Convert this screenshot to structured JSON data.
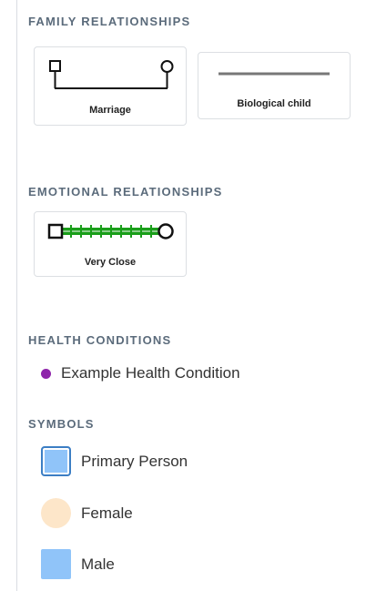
{
  "sections": {
    "family": {
      "title": "FAMILY RELATIONSHIPS",
      "items": [
        {
          "label": "Marriage",
          "icon": "marriage-connector-icon"
        },
        {
          "label": "Biological child",
          "icon": "biological-child-line-icon"
        }
      ]
    },
    "emotional": {
      "title": "EMOTIONAL RELATIONSHIPS",
      "items": [
        {
          "label": "Very Close",
          "icon": "very-close-connector-icon",
          "color": "#1a9e1a"
        }
      ]
    },
    "health": {
      "title": "HEALTH CONDITIONS",
      "items": [
        {
          "label": "Example Health Condition",
          "color": "#8e24aa"
        }
      ]
    },
    "symbols": {
      "title": "SYMBOLS",
      "items": [
        {
          "label": "Primary Person",
          "color": "#90c4f9",
          "border": "#3c7ec4"
        },
        {
          "label": "Female",
          "color": "#fde6c9"
        },
        {
          "label": "Male",
          "color": "#90c4f9"
        }
      ]
    }
  }
}
